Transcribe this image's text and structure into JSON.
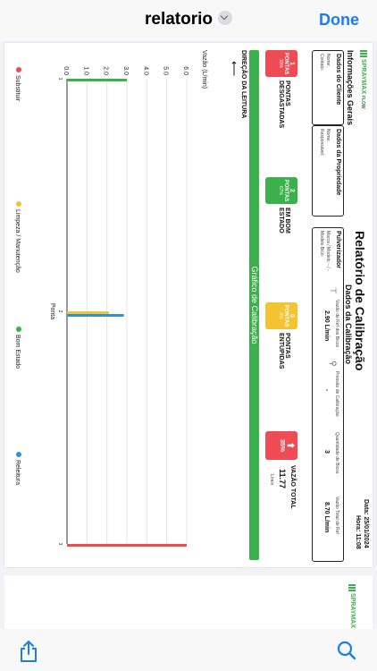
{
  "nav": {
    "title": "relatorio",
    "done": "Done"
  },
  "report": {
    "brand": "SPRAYMAX",
    "brand_sub": "FLOW",
    "title": "Relatório de Calibração",
    "date": "Data: 25/01/2024",
    "time": "Hora: 11:08",
    "info_title": "Informações Gerais",
    "cliente_title": "Dados do Cliente",
    "cliente_nome": "Nome:",
    "cliente_contato": "Contato:",
    "propriedade_title": "Dados da Propriedade",
    "propriedade_nome": "Nome:",
    "propriedade_resp": "Responsável:",
    "calibracao_title": "Dados da Calibração",
    "pulverizador_title": "Pulverizador",
    "marca": "Marca / Modelo: - / -",
    "modelo_bico": "Modelo Bico:",
    "vazao_ref_label": "Vazão de Ref dos Bicos",
    "vazao_ref_value": "2.90 L/min",
    "pressao_label": "Pressão de Calibração",
    "pressao_value": "-",
    "qtd_bicos_label": "Quantidade de Bicos",
    "qtd_bicos_value": "3",
    "vazao_total_ref_label": "Vazão Total de Ref",
    "vazao_total_ref_value": "8.70 L/min",
    "tiles": [
      {
        "count": "1",
        "word": "PONTAS",
        "pct": "33%",
        "label": "PONTAS DESGASTADAS"
      },
      {
        "count": "2",
        "word": "PONTAS",
        "pct": "67%",
        "label": "EM BOM ESTADO"
      },
      {
        "count": "0",
        "word": "PONTAS",
        "pct": "0%",
        "label": "PONTAS ENTUPIDAS"
      }
    ],
    "vazao_total": {
      "pct": "35%",
      "label": "VAZÃO TOTAL",
      "value": "11.77",
      "unit": "L/min"
    },
    "grafico_label": "Gráfico de Calibração",
    "direcao": "DIREÇÃO DA LEITURA"
  },
  "chart_data": {
    "type": "bar",
    "categories": [
      "1",
      "2",
      "3"
    ],
    "series": [
      {
        "name": "Substituir",
        "color": "#ee4b55",
        "values": [
          0,
          0,
          6.0
        ]
      },
      {
        "name": "Limpeza / Manutenção",
        "color": "#f3c332",
        "values": [
          0,
          2.1,
          0
        ]
      },
      {
        "name": "Bom Estado",
        "color": "#3cb04a",
        "values": [
          3.0,
          0,
          0
        ]
      },
      {
        "name": "Releitura",
        "color": "#2f8fe0",
        "values": [
          0,
          2.85,
          0
        ]
      }
    ],
    "xlabel": "Ponta",
    "ylabel": "Vazão (L/min)",
    "ylim": [
      0,
      6
    ],
    "yticks": [
      "0.0",
      "1.0",
      "2.0",
      "3.0",
      "4.0",
      "5.0",
      "6.0"
    ],
    "grid": true,
    "legend_position": "bottom"
  }
}
